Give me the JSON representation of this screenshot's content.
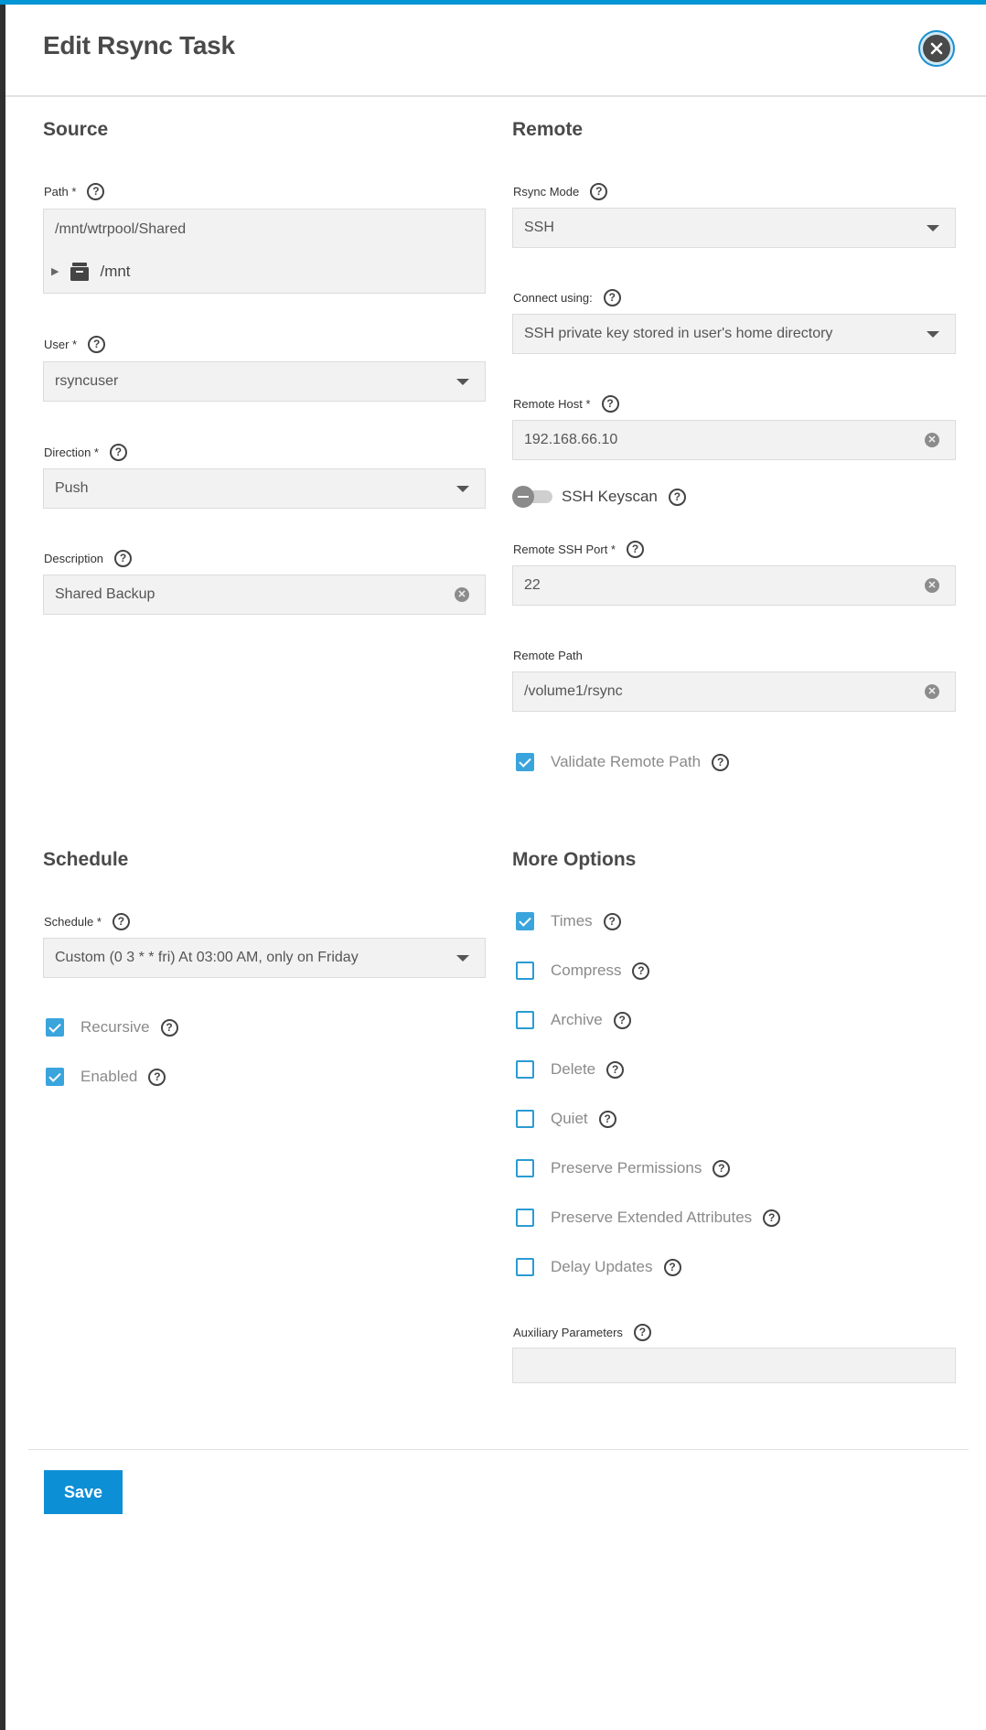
{
  "dialog": {
    "title": "Edit Rsync Task",
    "close_icon": "close-icon",
    "save_label": "Save"
  },
  "source": {
    "heading": "Source",
    "path": {
      "label": "Path *",
      "value": "/mnt/wtrpool/Shared",
      "tree_root": "/mnt"
    },
    "user": {
      "label": "User *",
      "value": "rsyncuser"
    },
    "direction": {
      "label": "Direction *",
      "value": "Push"
    },
    "description": {
      "label": "Description",
      "value": "Shared Backup"
    }
  },
  "remote": {
    "heading": "Remote",
    "rsync_mode": {
      "label": "Rsync Mode",
      "value": "SSH"
    },
    "connect_using": {
      "label": "Connect using:",
      "value": "SSH private key stored in user's home directory"
    },
    "remote_host": {
      "label": "Remote Host *",
      "value": "192.168.66.10"
    },
    "ssh_keyscan": {
      "label": "SSH Keyscan",
      "enabled": false
    },
    "remote_ssh_port": {
      "label": "Remote SSH Port *",
      "value": "22"
    },
    "remote_path": {
      "label": "Remote Path",
      "value": "/volume1/rsync"
    },
    "validate_remote_path": {
      "label": "Validate Remote Path",
      "checked": true
    }
  },
  "schedule": {
    "heading": "Schedule",
    "schedule": {
      "label": "Schedule *",
      "value": "Custom (0 3 * * fri) At 03:00 AM, only on Friday"
    },
    "recursive": {
      "label": "Recursive",
      "checked": true
    },
    "enabled": {
      "label": "Enabled",
      "checked": true
    }
  },
  "more_options": {
    "heading": "More Options",
    "options": [
      {
        "label": "Times",
        "checked": true
      },
      {
        "label": "Compress",
        "checked": false
      },
      {
        "label": "Archive",
        "checked": false
      },
      {
        "label": "Delete",
        "checked": false
      },
      {
        "label": "Quiet",
        "checked": false
      },
      {
        "label": "Preserve Permissions",
        "checked": false
      },
      {
        "label": "Preserve Extended Attributes",
        "checked": false
      },
      {
        "label": "Delay Updates",
        "checked": false
      }
    ],
    "auxiliary": {
      "label": "Auxiliary Parameters",
      "value": ""
    }
  },
  "colors": {
    "accent": "#0095d5",
    "checkbox": "#3aa4dc",
    "save_button": "#0d8fd6"
  }
}
